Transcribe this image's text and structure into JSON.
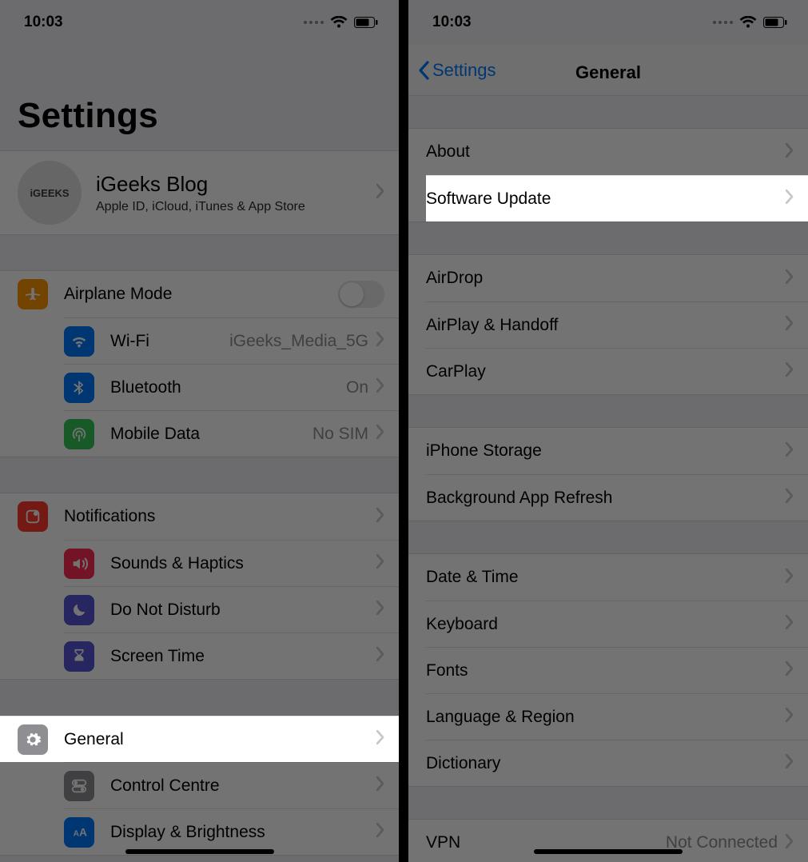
{
  "status": {
    "time": "10:03"
  },
  "left": {
    "title": "Settings",
    "profile": {
      "name": "iGeeks Blog",
      "subtitle": "Apple ID, iCloud, iTunes & App Store",
      "avatar_text": "iGEEKS"
    },
    "group1": [
      {
        "key": "airplane",
        "label": "Airplane Mode",
        "value": "",
        "type": "toggle",
        "icon": "airplane",
        "color": "#ff9500"
      },
      {
        "key": "wifi",
        "label": "Wi-Fi",
        "value": "iGeeks_Media_5G",
        "type": "nav",
        "icon": "wifi",
        "color": "#007aff"
      },
      {
        "key": "bluetooth",
        "label": "Bluetooth",
        "value": "On",
        "type": "nav",
        "icon": "bluetooth",
        "color": "#007aff"
      },
      {
        "key": "mobile",
        "label": "Mobile Data",
        "value": "No SIM",
        "type": "nav",
        "icon": "antenna",
        "color": "#34c759"
      }
    ],
    "group2": [
      {
        "key": "notifications",
        "label": "Notifications",
        "icon": "bell",
        "color": "#ff3b30"
      },
      {
        "key": "sounds",
        "label": "Sounds & Haptics",
        "icon": "speaker",
        "color": "#ff2d55"
      },
      {
        "key": "dnd",
        "label": "Do Not Disturb",
        "icon": "moon",
        "color": "#5856d6"
      },
      {
        "key": "screentime",
        "label": "Screen Time",
        "icon": "hourglass",
        "color": "#5856d6"
      }
    ],
    "group3": [
      {
        "key": "general",
        "label": "General",
        "icon": "gear",
        "color": "#8e8e93",
        "highlight": true
      },
      {
        "key": "control",
        "label": "Control Centre",
        "icon": "switches",
        "color": "#8e8e93"
      },
      {
        "key": "display",
        "label": "Display & Brightness",
        "icon": "aa",
        "color": "#007aff"
      }
    ]
  },
  "right": {
    "back_label": "Settings",
    "title": "General",
    "groups": [
      [
        {
          "key": "about",
          "label": "About"
        },
        {
          "key": "swu",
          "label": "Software Update",
          "highlight": true
        }
      ],
      [
        {
          "key": "airdrop",
          "label": "AirDrop"
        },
        {
          "key": "airplay",
          "label": "AirPlay & Handoff"
        },
        {
          "key": "carplay",
          "label": "CarPlay"
        }
      ],
      [
        {
          "key": "storage",
          "label": "iPhone Storage"
        },
        {
          "key": "bgapp",
          "label": "Background App Refresh"
        }
      ],
      [
        {
          "key": "datetime",
          "label": "Date & Time"
        },
        {
          "key": "keyboard",
          "label": "Keyboard"
        },
        {
          "key": "fonts",
          "label": "Fonts"
        },
        {
          "key": "lang",
          "label": "Language & Region"
        },
        {
          "key": "dict",
          "label": "Dictionary"
        }
      ],
      [
        {
          "key": "vpn",
          "label": "VPN",
          "value": "Not Connected"
        }
      ]
    ]
  }
}
